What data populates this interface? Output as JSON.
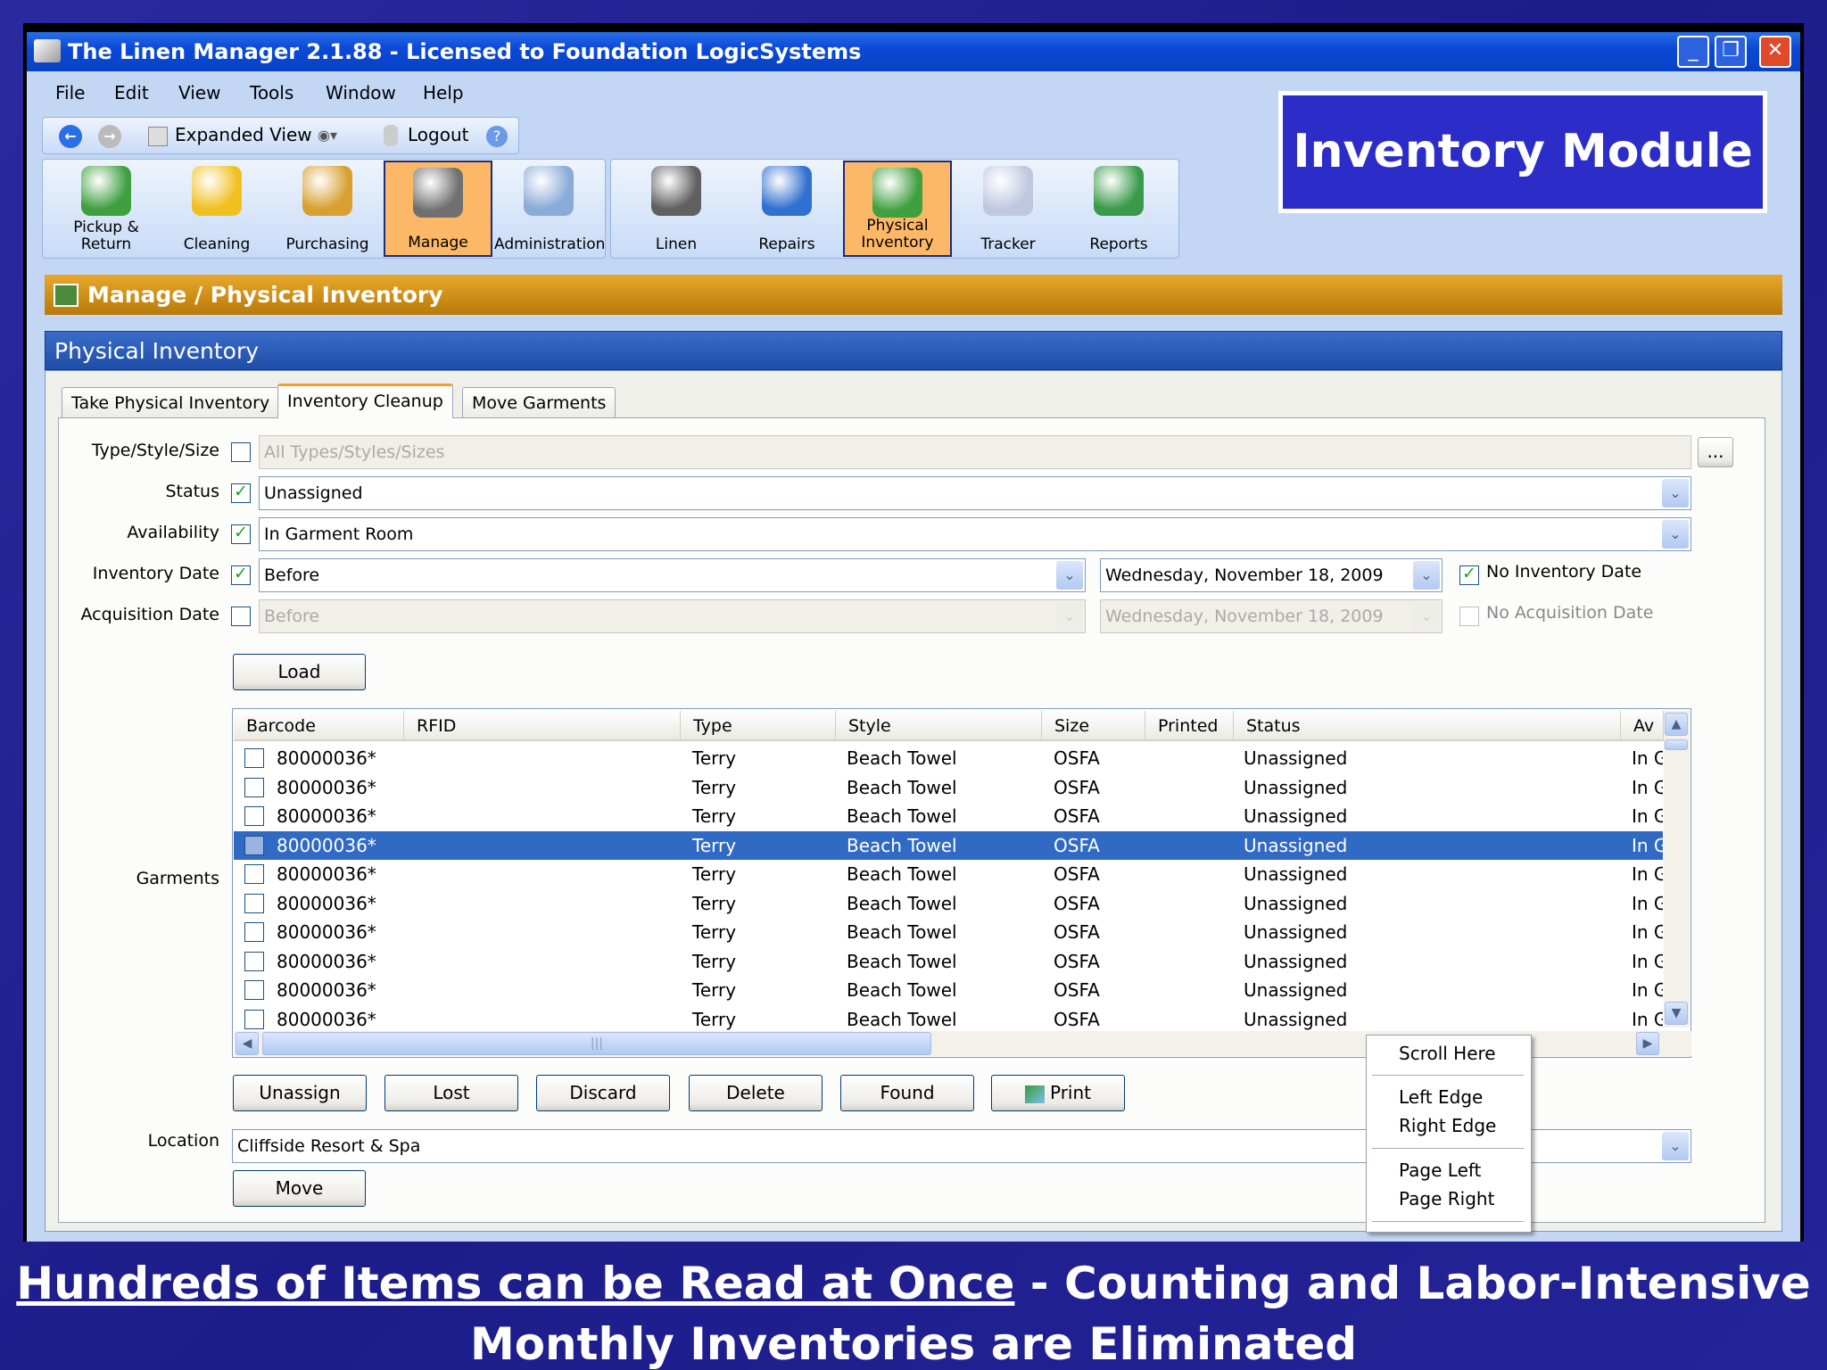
{
  "window": {
    "title": "The Linen Manager 2.1.88 - Licensed to Foundation LogicSystems",
    "minimize": "_",
    "restore": "❐",
    "close": "✕"
  },
  "menu": [
    "File",
    "Edit",
    "View",
    "Tools",
    "Window",
    "Help"
  ],
  "toolbar": {
    "expanded_view": "Expanded View",
    "logout": "Logout"
  },
  "modules": [
    {
      "label": "Pickup & Return",
      "color": "#40a040"
    },
    {
      "label": "Cleaning",
      "color": "#f0c020"
    },
    {
      "label": "Purchasing",
      "color": "#d8a030"
    },
    {
      "label": "Manage",
      "color": "#707070",
      "active": true
    },
    {
      "label": "Administration",
      "color": "#8aaad8"
    },
    {
      "label": "Linen",
      "color": "#606060"
    },
    {
      "label": "Repairs",
      "color": "#3070d0"
    },
    {
      "label": "Physical Inventory",
      "color": "#40a040",
      "active": true
    },
    {
      "label": "Tracker",
      "color": "#c0c8e0"
    },
    {
      "label": "Reports",
      "color": "#3a9a4a"
    }
  ],
  "badge": "Inventory Module",
  "breadcrumb": "Manage / Physical Inventory",
  "panel_title": "Physical Inventory",
  "tabs": [
    "Take Physical Inventory",
    "Inventory Cleanup",
    "Move Garments"
  ],
  "filters": {
    "type_label": "Type/Style/Size",
    "type_placeholder": "All Types/Styles/Sizes",
    "browse": "...",
    "status_label": "Status",
    "status_value": "Unassigned",
    "availability_label": "Availability",
    "availability_value": "In Garment Room",
    "inv_date_label": "Inventory Date",
    "inv_date_op": "Before",
    "inv_date": "Wednesday, November 18, 2009",
    "no_inv_date": "No Inventory Date",
    "acq_date_label": "Acquisition Date",
    "acq_date_op": "Before",
    "acq_date": "Wednesday, November 18, 2009",
    "no_acq_date": "No Acquisition Date"
  },
  "load": "Load",
  "garments_label": "Garments",
  "columns": [
    "Barcode",
    "RFID",
    "Type",
    "Style",
    "Size",
    "Printed",
    "Status",
    "Av"
  ],
  "rows": [
    {
      "barcode": "80000036*",
      "type": "Terry",
      "style": "Beach Towel",
      "size": "OSFA",
      "status": "Unassigned",
      "av": "In G"
    },
    {
      "barcode": "80000036*",
      "type": "Terry",
      "style": "Beach Towel",
      "size": "OSFA",
      "status": "Unassigned",
      "av": "In G"
    },
    {
      "barcode": "80000036*",
      "type": "Terry",
      "style": "Beach Towel",
      "size": "OSFA",
      "status": "Unassigned",
      "av": "In G"
    },
    {
      "barcode": "80000036*",
      "type": "Terry",
      "style": "Beach Towel",
      "size": "OSFA",
      "status": "Unassigned",
      "av": "In G",
      "selected": true
    },
    {
      "barcode": "80000036*",
      "type": "Terry",
      "style": "Beach Towel",
      "size": "OSFA",
      "status": "Unassigned",
      "av": "In G"
    },
    {
      "barcode": "80000036*",
      "type": "Terry",
      "style": "Beach Towel",
      "size": "OSFA",
      "status": "Unassigned",
      "av": "In G"
    },
    {
      "barcode": "80000036*",
      "type": "Terry",
      "style": "Beach Towel",
      "size": "OSFA",
      "status": "Unassigned",
      "av": "In G"
    },
    {
      "barcode": "80000036*",
      "type": "Terry",
      "style": "Beach Towel",
      "size": "OSFA",
      "status": "Unassigned",
      "av": "In G"
    },
    {
      "barcode": "80000036*",
      "type": "Terry",
      "style": "Beach Towel",
      "size": "OSFA",
      "status": "Unassigned",
      "av": "In G"
    },
    {
      "barcode": "80000036*",
      "type": "Terry",
      "style": "Beach Towel",
      "size": "OSFA",
      "status": "Unassigned",
      "av": "In G"
    }
  ],
  "actions": [
    "Unassign",
    "Lost",
    "Discard",
    "Delete",
    "Found",
    "Print"
  ],
  "location_label": "Location",
  "location_value": "Cliffside Resort & Spa",
  "move": "Move",
  "context_menu": [
    "Scroll Here",
    "Left Edge",
    "Right Edge",
    "Page Left",
    "Page Right"
  ],
  "caption": {
    "underlined": "Hundreds of Items can be Read at Once",
    "rest": " - Counting and Labor-Intensive",
    "line2": "Monthly Inventories are Eliminated"
  }
}
